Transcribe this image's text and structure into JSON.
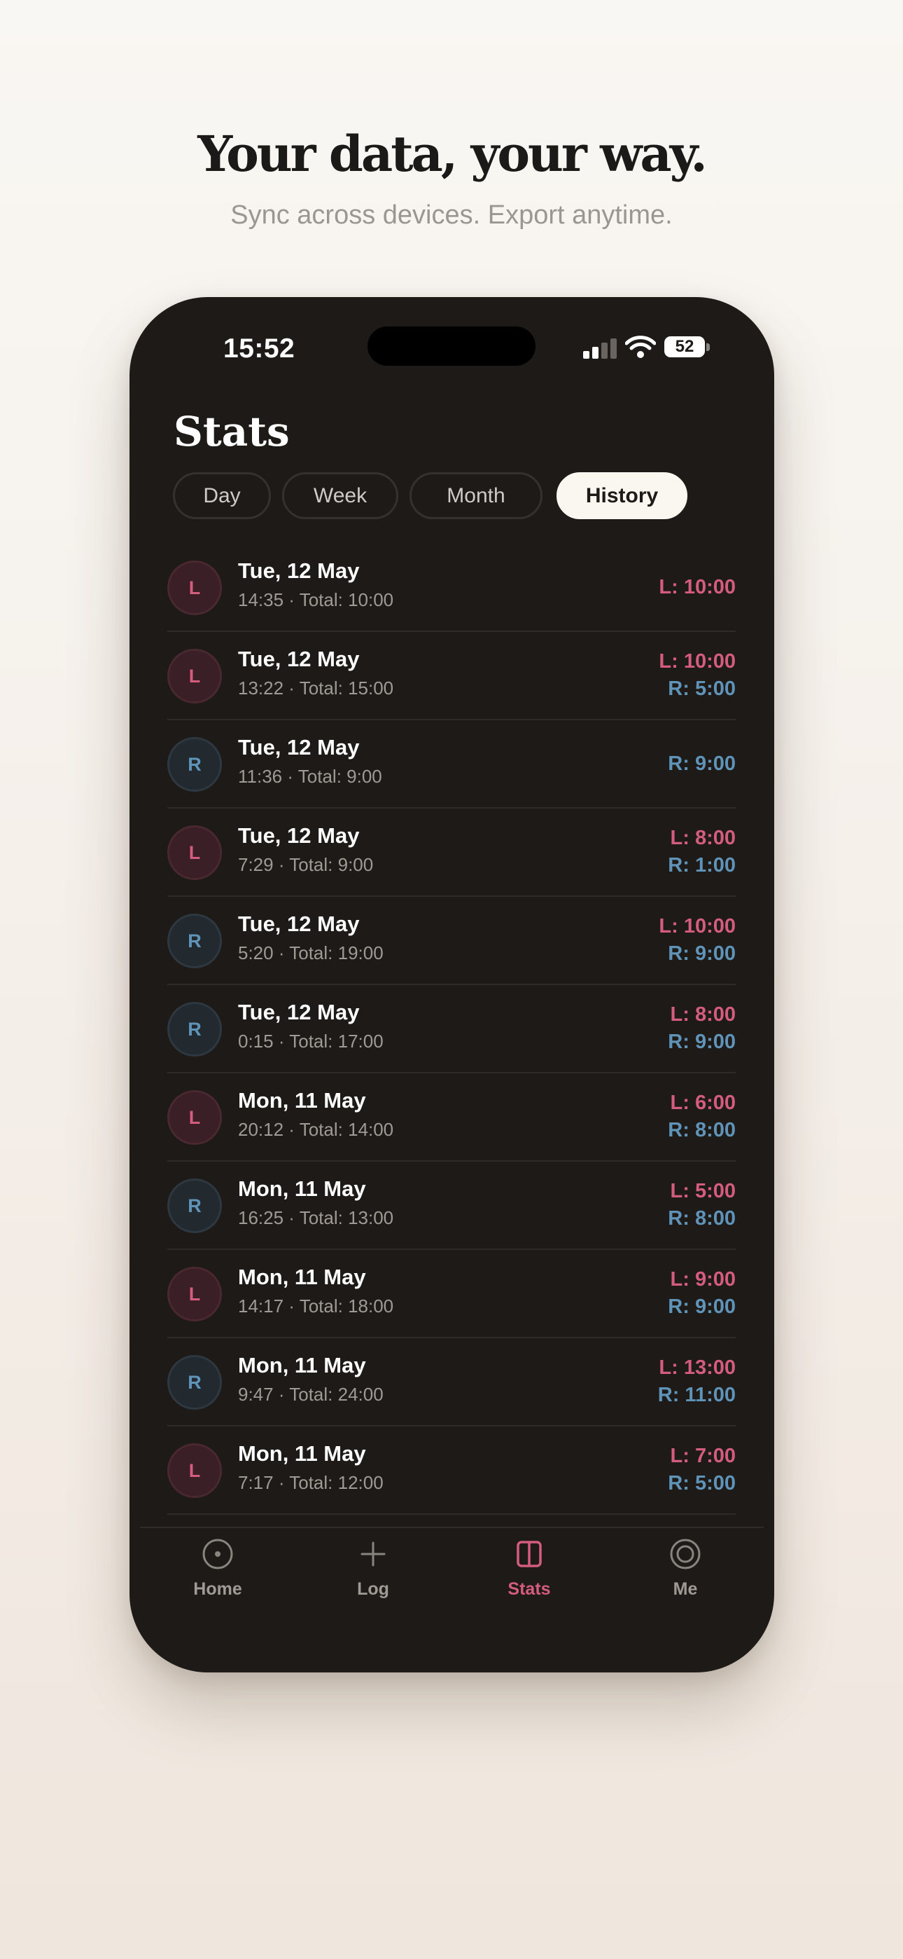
{
  "promo": {
    "headline": "Your data, your way.",
    "subline": "Sync across devices. Export anytime."
  },
  "status_bar": {
    "time": "15:52",
    "battery": "52"
  },
  "screen": {
    "title": "Stats",
    "tabs": [
      {
        "label": "Day",
        "active": false
      },
      {
        "label": "Week",
        "active": false
      },
      {
        "label": "Month",
        "active": false
      },
      {
        "label": "History",
        "active": true
      }
    ]
  },
  "history": [
    {
      "side": "L",
      "date": "Tue, 12 May",
      "sub": "14:35 · Total: 10:00",
      "left": "L: 10:00",
      "right": null
    },
    {
      "side": "L",
      "date": "Tue, 12 May",
      "sub": "13:22 · Total: 15:00",
      "left": "L: 10:00",
      "right": "R: 5:00"
    },
    {
      "side": "R",
      "date": "Tue, 12 May",
      "sub": "11:36 · Total: 9:00",
      "left": null,
      "right": "R: 9:00"
    },
    {
      "side": "L",
      "date": "Tue, 12 May",
      "sub": "7:29 · Total: 9:00",
      "left": "L: 8:00",
      "right": "R: 1:00"
    },
    {
      "side": "R",
      "date": "Tue, 12 May",
      "sub": "5:20 · Total: 19:00",
      "left": "L: 10:00",
      "right": "R: 9:00"
    },
    {
      "side": "R",
      "date": "Tue, 12 May",
      "sub": "0:15 · Total: 17:00",
      "left": "L: 8:00",
      "right": "R: 9:00"
    },
    {
      "side": "L",
      "date": "Mon, 11 May",
      "sub": "20:12 · Total: 14:00",
      "left": "L: 6:00",
      "right": "R: 8:00"
    },
    {
      "side": "R",
      "date": "Mon, 11 May",
      "sub": "16:25 · Total: 13:00",
      "left": "L: 5:00",
      "right": "R: 8:00"
    },
    {
      "side": "L",
      "date": "Mon, 11 May",
      "sub": "14:17 · Total: 18:00",
      "left": "L: 9:00",
      "right": "R: 9:00"
    },
    {
      "side": "R",
      "date": "Mon, 11 May",
      "sub": "9:47 · Total: 24:00",
      "left": "L: 13:00",
      "right": "R: 11:00"
    },
    {
      "side": "L",
      "date": "Mon, 11 May",
      "sub": "7:17 · Total: 12:00",
      "left": "L: 7:00",
      "right": "R: 5:00"
    }
  ],
  "nav": [
    {
      "label": "Home",
      "icon": "home-icon",
      "active": false
    },
    {
      "label": "Log",
      "icon": "plus-icon",
      "active": false
    },
    {
      "label": "Stats",
      "icon": "stats-icon",
      "active": true
    },
    {
      "label": "Me",
      "icon": "profile-icon",
      "active": false
    }
  ],
  "colors": {
    "left_accent": "#d45c7d",
    "right_accent": "#5f93b8",
    "phone_bg": "#1e1a18",
    "active_tab_bg": "#faf6f0"
  }
}
